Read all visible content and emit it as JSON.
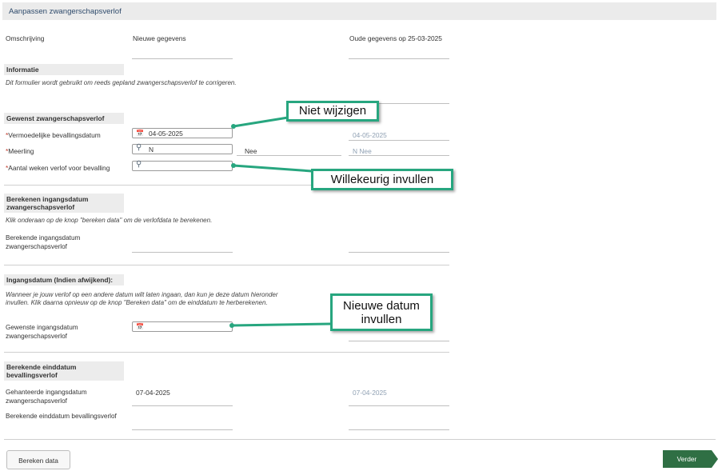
{
  "header": {
    "title": "Aanpassen zwangerschapsverlof"
  },
  "columns": {
    "omschrijving": "Omschrijving",
    "nieuw": "Nieuwe gegevens",
    "oud": "Oude gegevens op 25-03-2025"
  },
  "info": {
    "title": "Informatie",
    "text": "Dit formulier wordt gebruikt om reeds gepland zwangerschapsverlof te corrigeren."
  },
  "gewenst": {
    "title": "Gewenst zwangerschapsverlof",
    "req_mark": "*",
    "bevalling_label": "Vermoedelijke bevallingsdatum",
    "bevalling_value": "04-05-2025",
    "bevalling_old": "04-05-2025",
    "meerling_label": "Meerling",
    "meerling_value": "N",
    "meerling_desc": "Nee",
    "meerling_old": "N Nee",
    "weken_label": "Aantal weken verlof voor bevalling",
    "weken_value": ""
  },
  "berekenen": {
    "title": "Berekenen ingangsdatum zwangerschapsverlof",
    "text": "Klik onderaan op de knop \"bereken data\" om de verlofdata te berekenen.",
    "ingang_label": "Berekende ingangsdatum zwangerschapsverlof"
  },
  "afwijkend": {
    "title": "Ingangsdatum (Indien afwijkend):",
    "text": "Wanneer je jouw verlof op een andere datum wilt laten ingaan, dan kun je deze datum hieronder invullen. Klik daarna opnieuw op de knop \"Bereken data\" om de einddatum te herberekenen.",
    "gewenst_label": "Gewenste ingangsdatum zwangerschapsverlof",
    "gewenst_value": ""
  },
  "einde": {
    "title": "Berekende einddatum bevallingsverlof",
    "gehanteerd_label": "Gehanteerde ingangsdatum zwangerschapsverlof",
    "gehanteerd_value": "07-04-2025",
    "gehanteerd_old": "07-04-2025",
    "eind_label": "Berekende einddatum bevallingsverlof"
  },
  "callouts": {
    "niet_wijzigen": "Niet wijzigen",
    "willekeurig": "Willekeurig invullen",
    "nieuwe_datum": "Nieuwe datum invullen"
  },
  "buttons": {
    "bereken": "Bereken data",
    "verder": "Verder"
  },
  "colors": {
    "callout_border": "#27a67f",
    "primary_button": "#2f6f44",
    "required": "#c0392b"
  },
  "icons": {
    "calendar": "calendar-icon",
    "search": "search-icon"
  }
}
